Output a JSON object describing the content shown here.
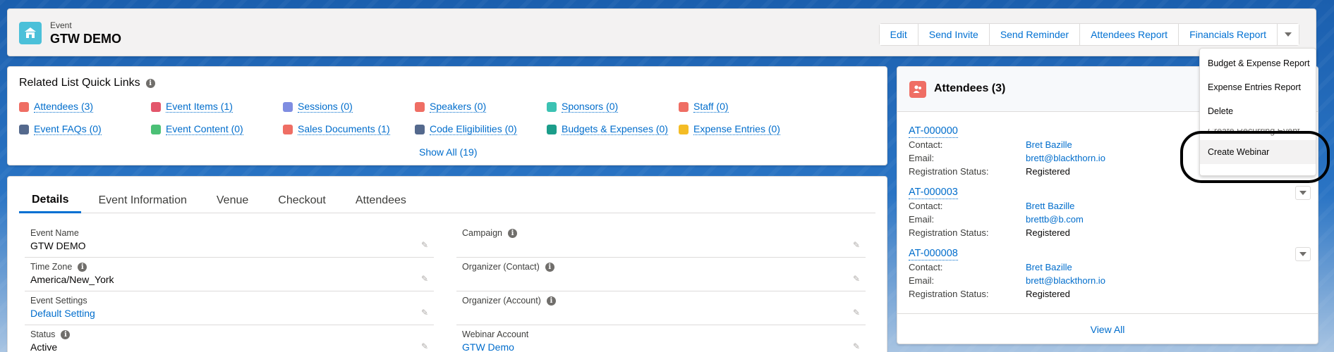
{
  "header": {
    "type": "Event",
    "title": "GTW DEMO",
    "buttons": [
      "Edit",
      "Send Invite",
      "Send Reminder",
      "Attendees Report",
      "Financials Report"
    ],
    "icon": "event-icon"
  },
  "quick_links": {
    "title": "Related List Quick Links",
    "items": [
      {
        "label": "Attendees (3)",
        "color": "#ef6e64"
      },
      {
        "label": "Event Items (1)",
        "color": "#e3566b"
      },
      {
        "label": "Sessions (0)",
        "color": "#7f8de1"
      },
      {
        "label": "Speakers (0)",
        "color": "#ef6e64"
      },
      {
        "label": "Sponsors (0)",
        "color": "#3cc2b3"
      },
      {
        "label": "Staff (0)",
        "color": "#ef6e64"
      },
      {
        "label": "Event FAQs (0)",
        "color": "#54698d"
      },
      {
        "label": "Event Content (0)",
        "color": "#4bc076"
      },
      {
        "label": "Sales Documents (1)",
        "color": "#ef6e64"
      },
      {
        "label": "Code Eligibilities (0)",
        "color": "#54698d"
      },
      {
        "label": "Budgets & Expenses (0)",
        "color": "#1b9d8a"
      },
      {
        "label": "Expense Entries (0)",
        "color": "#f4bc25"
      }
    ],
    "show_all": "Show All (19)"
  },
  "details": {
    "tabs": [
      "Details",
      "Event Information",
      "Venue",
      "Checkout",
      "Attendees"
    ],
    "fields_left": [
      {
        "label": "Event Name",
        "value": "GTW DEMO"
      },
      {
        "label": "Time Zone",
        "value": "America/New_York"
      },
      {
        "label": "Event Settings",
        "value": "Default Setting"
      },
      {
        "label": "Status",
        "value": "Active"
      }
    ],
    "fields_right": [
      {
        "label": "Campaign",
        "value": ""
      },
      {
        "label": "Organizer (Contact)",
        "value": ""
      },
      {
        "label": "Organizer (Account)",
        "value": ""
      },
      {
        "label": "Webinar Account",
        "value": "GTW Demo"
      }
    ]
  },
  "attendees": {
    "title": "Attendees (3)",
    "labels": {
      "contact": "Contact:",
      "email": "Email:",
      "status": "Registration Status:"
    },
    "records": [
      {
        "id": "AT-000000",
        "contact": "Bret Bazille",
        "email": "brett@blackthorn.io",
        "status": "Registered"
      },
      {
        "id": "AT-000003",
        "contact": "Brett Bazille",
        "email": "brettb@b.com",
        "status": "Registered"
      },
      {
        "id": "AT-000008",
        "contact": "Bret Bazille",
        "email": "brett@blackthorn.io",
        "status": "Registered"
      }
    ],
    "view_all": "View All"
  },
  "menu": {
    "items": [
      "Budget & Expense Report",
      "Expense Entries Report",
      "Delete",
      "Create Recurring Event",
      "Create Webinar"
    ]
  }
}
